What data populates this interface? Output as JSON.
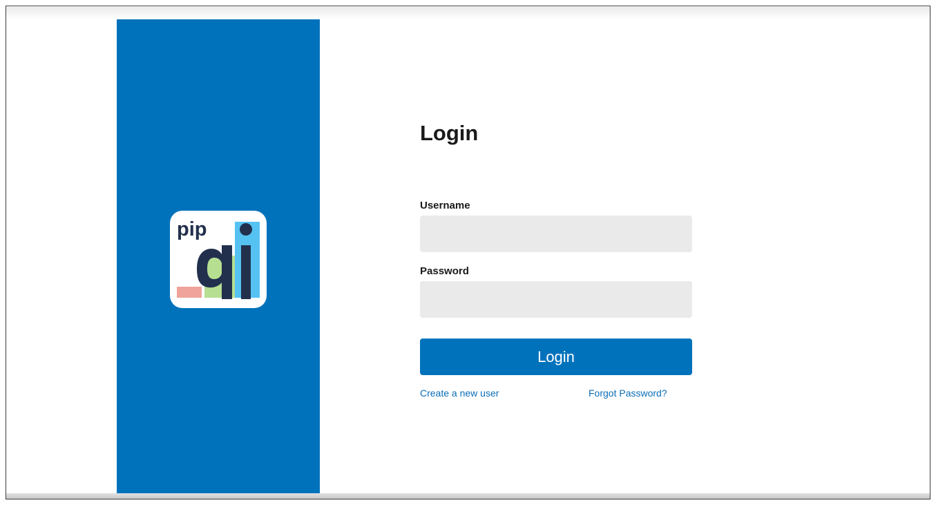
{
  "brand": {
    "logo_text_top": "pip",
    "logo_text_main": "qi",
    "panel_color": "#0072bc"
  },
  "login": {
    "title": "Login",
    "username_label": "Username",
    "username_value": "",
    "password_label": "Password",
    "password_value": "",
    "submit_label": "Login",
    "create_user_link": "Create a new user",
    "forgot_password_link": "Forgot Password?"
  },
  "colors": {
    "accent": "#0072bc",
    "input_background": "#eaeaea",
    "link": "#0b6db6"
  }
}
